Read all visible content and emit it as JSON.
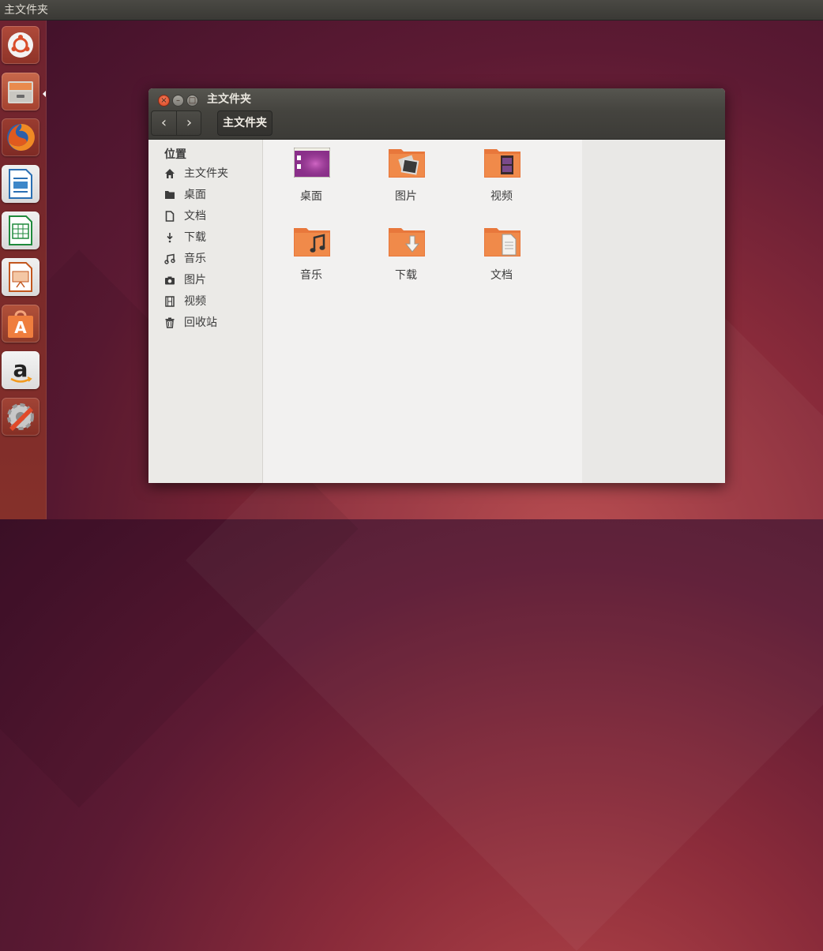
{
  "top_panel": {
    "title": "主文件夹"
  },
  "launcher": {
    "items": [
      {
        "name": "dash-home-icon"
      },
      {
        "name": "files-icon"
      },
      {
        "name": "firefox-icon"
      },
      {
        "name": "libreoffice-writer-icon"
      },
      {
        "name": "libreoffice-calc-icon"
      },
      {
        "name": "libreoffice-impress-icon"
      },
      {
        "name": "software-center-icon"
      },
      {
        "name": "amazon-icon"
      },
      {
        "name": "system-settings-icon"
      }
    ]
  },
  "window": {
    "title": "主文件夹",
    "close_glyph": "×",
    "min_glyph": "–",
    "max_glyph": "□",
    "back_glyph": "‹",
    "forward_glyph": "›",
    "path_label": "主文件夹"
  },
  "sidebar": {
    "heading": "位置",
    "items": [
      {
        "label": "主文件夹",
        "icon": "home-icon"
      },
      {
        "label": "桌面",
        "icon": "folder-icon"
      },
      {
        "label": "文档",
        "icon": "document-icon"
      },
      {
        "label": "下载",
        "icon": "download-icon"
      },
      {
        "label": "音乐",
        "icon": "music-icon"
      },
      {
        "label": "图片",
        "icon": "camera-icon"
      },
      {
        "label": "视频",
        "icon": "film-icon"
      },
      {
        "label": "回收站",
        "icon": "trash-icon"
      }
    ]
  },
  "files": [
    {
      "label": "桌面",
      "icon": "desktop-folder-icon"
    },
    {
      "label": "图片",
      "icon": "pictures-folder-icon"
    },
    {
      "label": "视频",
      "icon": "videos-folder-icon"
    },
    {
      "label": "音乐",
      "icon": "music-folder-icon"
    },
    {
      "label": "下载",
      "icon": "downloads-folder-icon"
    },
    {
      "label": "文档",
      "icon": "documents-folder-icon"
    }
  ],
  "colors": {
    "accent": "#e95420",
    "folder": "#e8773b",
    "desktop_purple": "#8a2f8a"
  }
}
